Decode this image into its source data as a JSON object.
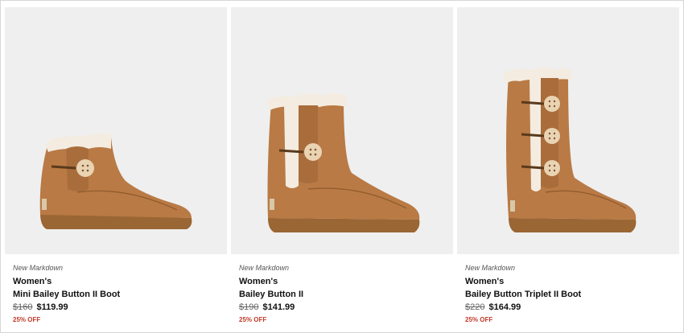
{
  "products": [
    {
      "badge": "New Markdown",
      "gender": "Women's",
      "name": "Mini Bailey Button II Boot",
      "original_price": "$160",
      "sale_price": "$119.99",
      "discount": "25% OFF"
    },
    {
      "badge": "New Markdown",
      "gender": "Women's",
      "name": "Bailey Button II",
      "original_price": "$190",
      "sale_price": "$141.99",
      "discount": "25% OFF"
    },
    {
      "badge": "New Markdown",
      "gender": "Women's",
      "name": "Bailey Button Triplet II Boot",
      "original_price": "$220",
      "sale_price": "$164.99",
      "discount": "25% OFF"
    }
  ],
  "colors": {
    "tile_background": "#efefef",
    "suede": "#b97a45",
    "sole": "#9a6633",
    "shearling": "#f4ece0",
    "discount": "#c0392b"
  }
}
